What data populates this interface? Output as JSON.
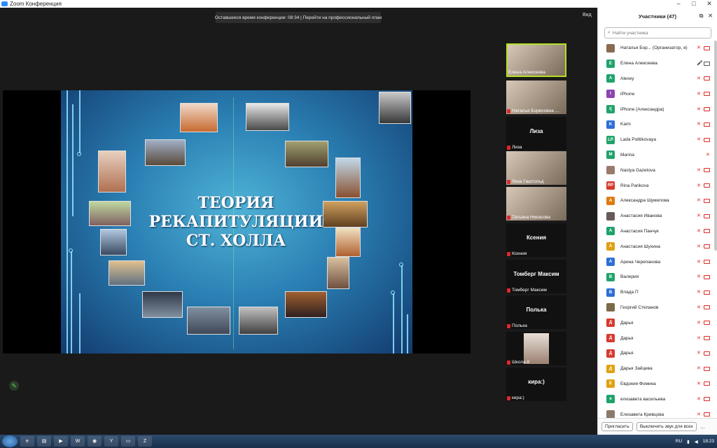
{
  "window": {
    "title": "Zoom Конференция"
  },
  "top_banner": {
    "text": "Оставшееся время конференции: 08:34 | Перейти на профессиональный план"
  },
  "view_button": "Вид",
  "slide": {
    "title_lines": [
      "ТЕОРИЯ",
      "РЕКАПИТУЛЯЦИИ",
      "СТ. ХОЛЛА"
    ]
  },
  "gallery": [
    {
      "caption": "Елена Алексеева",
      "big_name": "",
      "muted": false,
      "active": true,
      "video": true
    },
    {
      "caption": "Наталья Борисовна ...",
      "big_name": "",
      "muted": true,
      "active": false,
      "video": true
    },
    {
      "caption": "Лиза",
      "big_name": "Лиза",
      "muted": true,
      "active": false,
      "video": false
    },
    {
      "caption": "Лиза Гаштольд",
      "big_name": "",
      "muted": true,
      "active": false,
      "video": true
    },
    {
      "caption": "Татьяна Никасова",
      "big_name": "",
      "muted": true,
      "active": false,
      "video": true
    },
    {
      "caption": "Ксения",
      "big_name": "Ксения",
      "muted": true,
      "active": false,
      "video": false
    },
    {
      "caption": "Томберг Максим",
      "big_name": "Томберг Максим",
      "muted": true,
      "active": false,
      "video": false
    },
    {
      "caption": "Полька",
      "big_name": "Полька",
      "muted": true,
      "active": false,
      "video": false
    },
    {
      "caption": "Школа 8",
      "big_name": "",
      "muted": true,
      "active": false,
      "video": true
    },
    {
      "caption": "кира:)",
      "big_name": "кира:)",
      "muted": true,
      "active": false,
      "video": false
    }
  ],
  "participants_panel": {
    "title": "Участники (47)",
    "search_placeholder": "Найти участника",
    "participants": [
      {
        "initials": "",
        "color": "#8a6a50",
        "name": "Наталья Бор... (Организатор, я)",
        "mic": "muted",
        "cam": "off"
      },
      {
        "initials": "Е",
        "color": "#1fa36b",
        "name": "Елена Алексеева",
        "mic": "on",
        "cam": "on"
      },
      {
        "initials": "A",
        "color": "#1fa36b",
        "name": "Alexey",
        "mic": "muted",
        "cam": "off"
      },
      {
        "initials": "I",
        "color": "#8e44ad",
        "name": "iPhone",
        "mic": "muted",
        "cam": "off"
      },
      {
        "initials": "i(",
        "color": "#1fa36b",
        "name": "iPhone (Александра)",
        "mic": "muted",
        "cam": "off"
      },
      {
        "initials": "K",
        "color": "#2d6fd6",
        "name": "Kami",
        "mic": "muted",
        "cam": "off"
      },
      {
        "initials": "LP",
        "color": "#1fa36b",
        "name": "Lada Politikovaya",
        "mic": "muted",
        "cam": "off"
      },
      {
        "initials": "M",
        "color": "#1fa36b",
        "name": "Marina",
        "mic": "muted",
        "cam": "none"
      },
      {
        "initials": "",
        "color": "#9a7a6a",
        "name": "Nastya Gazetova",
        "mic": "muted",
        "cam": "off"
      },
      {
        "initials": "RP",
        "color": "#d63a2d",
        "name": "Rina Parikova",
        "mic": "muted",
        "cam": "off"
      },
      {
        "initials": "А",
        "color": "#e07a10",
        "name": "Александра Шумилова",
        "mic": "muted",
        "cam": "off"
      },
      {
        "initials": "",
        "color": "#6a5a5a",
        "name": "Анастасия Иванова",
        "mic": "muted",
        "cam": "off"
      },
      {
        "initials": "А",
        "color": "#1fa36b",
        "name": "Анастасия Панчук",
        "mic": "muted",
        "cam": "off"
      },
      {
        "initials": "А",
        "color": "#e0a010",
        "name": "Анастасия Шухина",
        "mic": "muted",
        "cam": "off"
      },
      {
        "initials": "А",
        "color": "#2d6fd6",
        "name": "Арина Черепанова",
        "mic": "muted",
        "cam": "off"
      },
      {
        "initials": "В",
        "color": "#1fa36b",
        "name": "Валерия",
        "mic": "muted",
        "cam": "off"
      },
      {
        "initials": "В",
        "color": "#2d6fd6",
        "name": "Влада П",
        "mic": "muted",
        "cam": "off"
      },
      {
        "initials": "",
        "color": "#7a6a4a",
        "name": "Георгий Степанов",
        "mic": "muted",
        "cam": "off"
      },
      {
        "initials": "Д",
        "color": "#d63a2d",
        "name": "Дарья",
        "mic": "muted",
        "cam": "off"
      },
      {
        "initials": "Д",
        "color": "#d63a2d",
        "name": "Дарья",
        "mic": "muted",
        "cam": "off"
      },
      {
        "initials": "Д",
        "color": "#d63a2d",
        "name": "Дарья",
        "mic": "muted",
        "cam": "off"
      },
      {
        "initials": "Д",
        "color": "#e0a010",
        "name": "Дарья Зайцева",
        "mic": "muted",
        "cam": "off"
      },
      {
        "initials": "Е",
        "color": "#e0a010",
        "name": "Евдокия Фомина",
        "mic": "muted",
        "cam": "off"
      },
      {
        "initials": "е",
        "color": "#1fa36b",
        "name": "елизавета васильева",
        "mic": "muted",
        "cam": "off"
      },
      {
        "initials": "",
        "color": "#8a7a6a",
        "name": "Елизавета Кривцова",
        "mic": "muted",
        "cam": "off"
      }
    ],
    "invite_button": "Пригласить",
    "mute_all_button": "Выключить звук для всех",
    "more_button": "..."
  },
  "taskbar": {
    "language": "RU",
    "clock": "18:23"
  },
  "colors": {
    "active_speaker_border": "#b6e026",
    "muted_red": "#e02828"
  }
}
